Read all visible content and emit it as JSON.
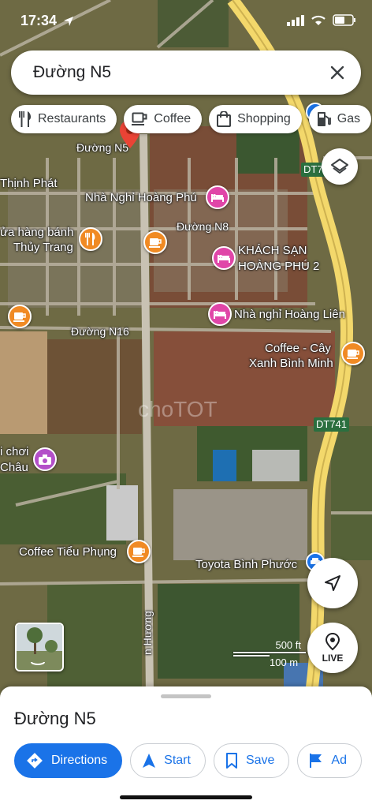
{
  "status": {
    "time": "17:34"
  },
  "search": {
    "query": "Đường N5"
  },
  "chips": [
    {
      "label": "Restaurants",
      "icon": "fork-knife-icon"
    },
    {
      "label": "Coffee",
      "icon": "coffee-cup-icon"
    },
    {
      "label": "Shopping",
      "icon": "shopping-bag-icon"
    },
    {
      "label": "Gas",
      "icon": "gas-pump-icon"
    }
  ],
  "map": {
    "labels": {
      "duong_n5": "Đường N5",
      "thinh_phat": "Thịnh Phát",
      "nha_nghi_hoang_phu": "Nhà Nghỉ Hoàng Phú",
      "duong_n8": "Đường N8",
      "cua_hang_banh": "ửa hàng bánh",
      "thuy_trang": "Thủy Trang",
      "khach_san_1": "KHÁCH SẠN",
      "khach_san_2": "HOÀNG PHÚ 2",
      "nha_nghi_hoang_lien": "Nhà nghỉ Hoàng Liên",
      "duong_n16": "Đường N16",
      "coffee_cay_1": "Coffee - Cây",
      "coffee_cay_2": "Xanh Bình Minh",
      "choi_1": "i chơi",
      "choi_2": "Châu",
      "coffee_tieu_phung": "Coffee Tiểu Phụng",
      "toyota": "Toyota Bình Phước",
      "huong": "n Hương",
      "dt741_a": "DT74",
      "dt741_b": "DT741",
      "watermark": "choTOT"
    },
    "scale": {
      "feet": "500 ft",
      "meters": "100 m"
    },
    "live_label": "LIVE"
  },
  "sheet": {
    "title": "Đường N5",
    "actions": [
      {
        "label": "Directions",
        "icon": "directions-icon"
      },
      {
        "label": "Start",
        "icon": "navigation-arrow-icon"
      },
      {
        "label": "Save",
        "icon": "bookmark-icon"
      },
      {
        "label": "Ad",
        "icon": "flag-icon"
      }
    ]
  },
  "colors": {
    "accent": "#1a73e8",
    "pin_orange": "#f08a24",
    "pin_pink": "#e046a8",
    "marker_red": "#ea4335",
    "highway": "#f3d86b"
  }
}
